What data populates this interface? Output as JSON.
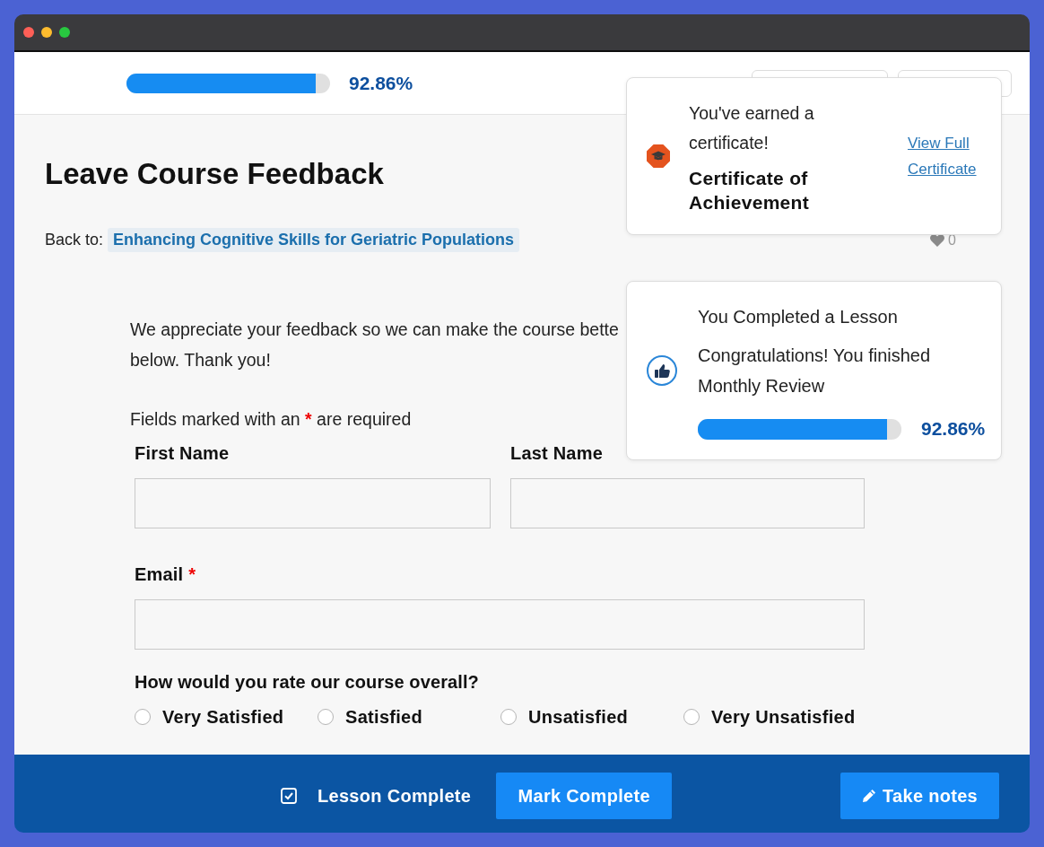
{
  "header": {
    "progress": {
      "level": 0.9286,
      "reading": "92.86%"
    }
  },
  "page": {
    "title": "Leave Course Feedback",
    "back_label": "Back to:",
    "course_link": "Enhancing Cognitive Skills for Geriatric Populations",
    "likes": "0"
  },
  "intro": {
    "lines": [
      "We appreciate your feedback so we can make the course bette",
      "below. Thank you!"
    ]
  },
  "required_note": {
    "before": "Fields marked with an",
    "mark": "*",
    "after": "are required"
  },
  "fields": [
    {
      "kind": "half",
      "label": "First Name"
    },
    {
      "kind": "half",
      "label": "Last Name"
    },
    {
      "kind": "full",
      "label": "Email",
      "required_mark": "*"
    }
  ],
  "rating": {
    "question": "How would you rate our course overall?",
    "options": [
      {
        "label": "Very Satisfied",
        "selected": false
      },
      {
        "label": "Satisfied",
        "selected": false
      },
      {
        "label": "Unsatisfied",
        "selected": false
      },
      {
        "label": "Very Unsatisfied",
        "selected": false
      }
    ]
  },
  "footer": {
    "lesson_complete": {
      "label": "Lesson Complete",
      "checked": true
    },
    "buttons": [
      {
        "kind": "primary",
        "label": "Mark Complete"
      },
      {
        "kind": "notes",
        "label": "Take notes"
      }
    ]
  },
  "notifications": [
    {
      "kind": "certificate",
      "message": "You've earned a certificate!",
      "title": "Certificate of Achievement",
      "link": "View Full Certificate"
    },
    {
      "kind": "lesson",
      "title": "You Completed a Lesson",
      "message": "Congratulations! You finished Monthly Review",
      "progress": {
        "level": 0.9286,
        "reading": "92.86%"
      }
    }
  ]
}
